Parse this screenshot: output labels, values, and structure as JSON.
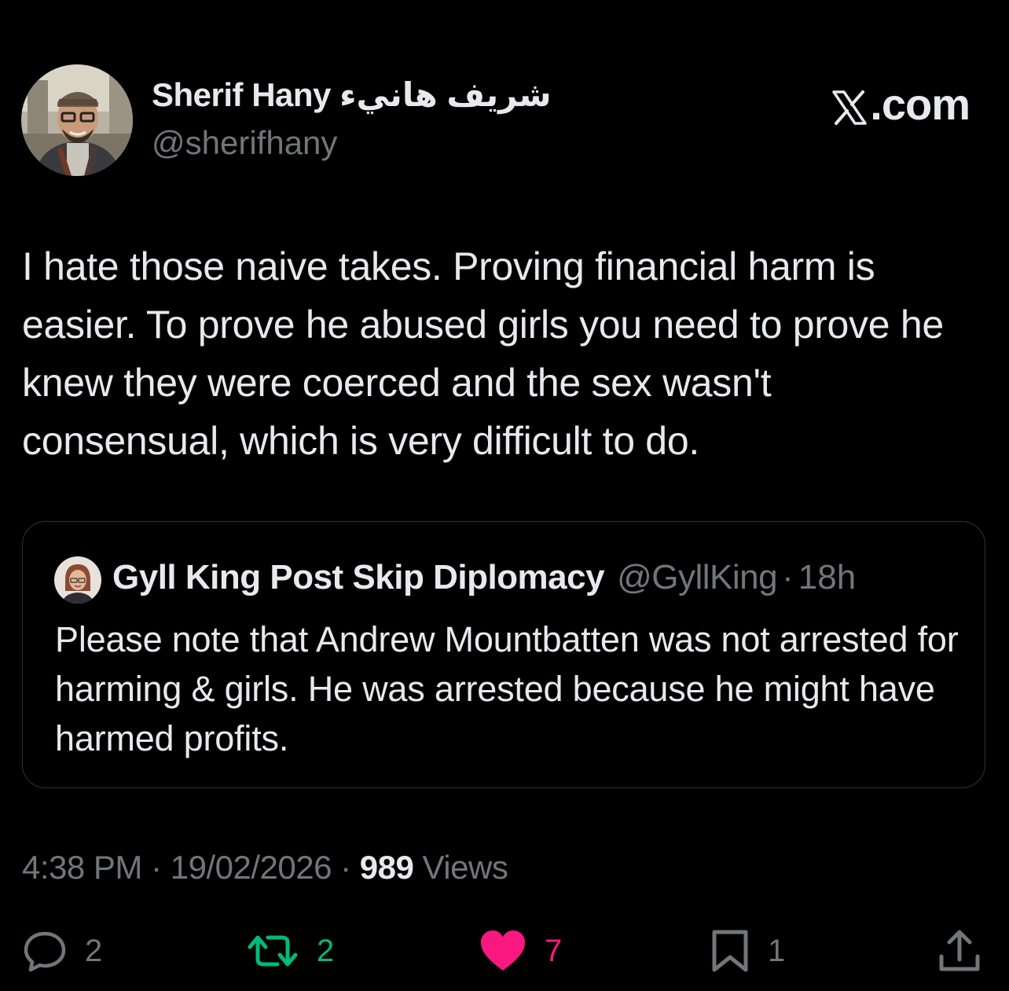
{
  "author": {
    "name": "Sherif Hany شريف هانيء",
    "handle": "@sherifhany"
  },
  "brand": {
    "label": ".com"
  },
  "tweet": {
    "text": "I hate those naive takes. Proving financial harm is easier. To prove he abused girls you need to prove he knew they were coerced and the sex wasn't consensual, which is very difficult to do."
  },
  "quote": {
    "name": "Gyll King Post Skip Diplomacy",
    "handle": "@GyllKing",
    "separator": "·",
    "time": "18h",
    "text": "Please note that Andrew Mountbatten was not arrested for harming & girls. He was arrested because he might have harmed profits."
  },
  "meta": {
    "time": "4:38 PM",
    "separator": " · ",
    "date": "19/02/2026",
    "views_count": "989",
    "views_label": " Views"
  },
  "actions": {
    "replies": "2",
    "retweets": "2",
    "likes": "7",
    "bookmarks": "1"
  },
  "colors": {
    "background": "#000000",
    "text": "#e7e9ea",
    "secondary": "#71767b",
    "border": "#2f3336",
    "retweet_active": "#00ba7c",
    "like_active": "#f91880"
  },
  "icons": {
    "reply": "reply-icon",
    "retweet": "retweet-icon",
    "like": "heart-icon",
    "bookmark": "bookmark-icon",
    "share": "share-icon",
    "brand": "x-logo-icon"
  }
}
